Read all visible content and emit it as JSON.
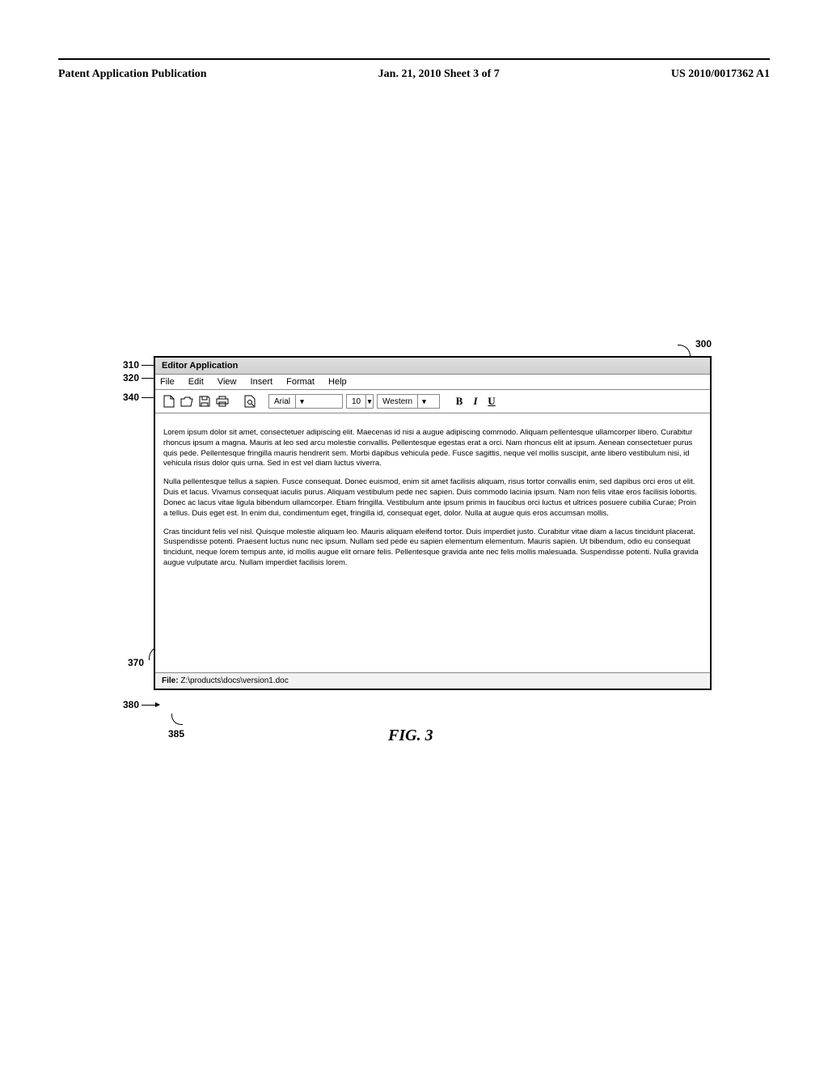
{
  "header": {
    "left": "Patent Application Publication",
    "center": "Jan. 21, 2010  Sheet 3 of 7",
    "right": "US 2010/0017362 A1"
  },
  "refs": {
    "r300": "300",
    "r310": "310",
    "r320": "320",
    "r340": "340",
    "r370": "370",
    "r380": "380",
    "r385": "385"
  },
  "titlebar": {
    "title": "Editor Application"
  },
  "menubar": {
    "items": [
      "File",
      "Edit",
      "View",
      "Insert",
      "Format",
      "Help"
    ]
  },
  "toolbar": {
    "font_name": "Arial",
    "font_size": "10",
    "charset": "Western",
    "bold": "B",
    "italic": "I",
    "underline": "U"
  },
  "content": {
    "p1": "Lorem ipsum dolor sit amet, consectetuer adipiscing elit. Maecenas id nisi a augue adipiscing commodo. Aliquam pellentesque ullamcorper libero. Curabitur rhoncus ipsum a magna. Mauris at leo sed arcu molestie convallis. Pellentesque egestas erat a orci. Nam rhoncus elit at ipsum. Aenean consectetuer purus quis pede. Pellentesque fringilla mauris hendrerit sem. Morbi dapibus vehicula pede. Fusce sagittis, neque vel mollis suscipit, ante libero vestibulum nisi, id vehicula risus dolor quis urna. Sed in est vel diam luctus viverra.",
    "p2": "Nulla pellentesque tellus a sapien. Fusce consequat. Donec euismod, enim sit amet facilisis aliquam, risus tortor convallis enim, sed dapibus orci eros ut elit. Duis et lacus. Vivamus consequat iaculis purus. Aliquam vestibulum pede nec sapien. Duis commodo lacinia ipsum. Nam non felis vitae eros facilisis lobortis. Donec ac lacus vitae ligula bibendum ullamcorper. Etiam fringilla. Vestibulum ante ipsum primis in faucibus orci luctus et ultrices posuere cubilia Curae; Proin a tellus. Duis eget est. In enim dui, condimentum eget, fringilla id, consequat eget, dolor. Nulla at augue quis eros accumsan mollis.",
    "p3": "Cras tincidunt felis vel nisl. Quisque molestie aliquam leo. Mauris aliquam eleifend tortor. Duis imperdiet justo. Curabitur vitae diam a lacus tincidunt placerat. Suspendisse potenti. Praesent luctus nunc nec ipsum. Nullam sed pede eu sapien elementum elementum. Mauris sapien. Ut bibendum, odio eu consequat tincidunt, neque lorem tempus ante, id mollis augue elit ornare felis. Pellentesque gravida ante nec felis mollis malesuada. Suspendisse potenti. Nulla gravida augue vulputate arcu. Nullam imperdiet facilisis lorem."
  },
  "statusbar": {
    "file_label": "File:",
    "file_path": "Z:\\products\\docs\\version1.doc"
  },
  "fig": {
    "caption": "FIG. 3"
  }
}
